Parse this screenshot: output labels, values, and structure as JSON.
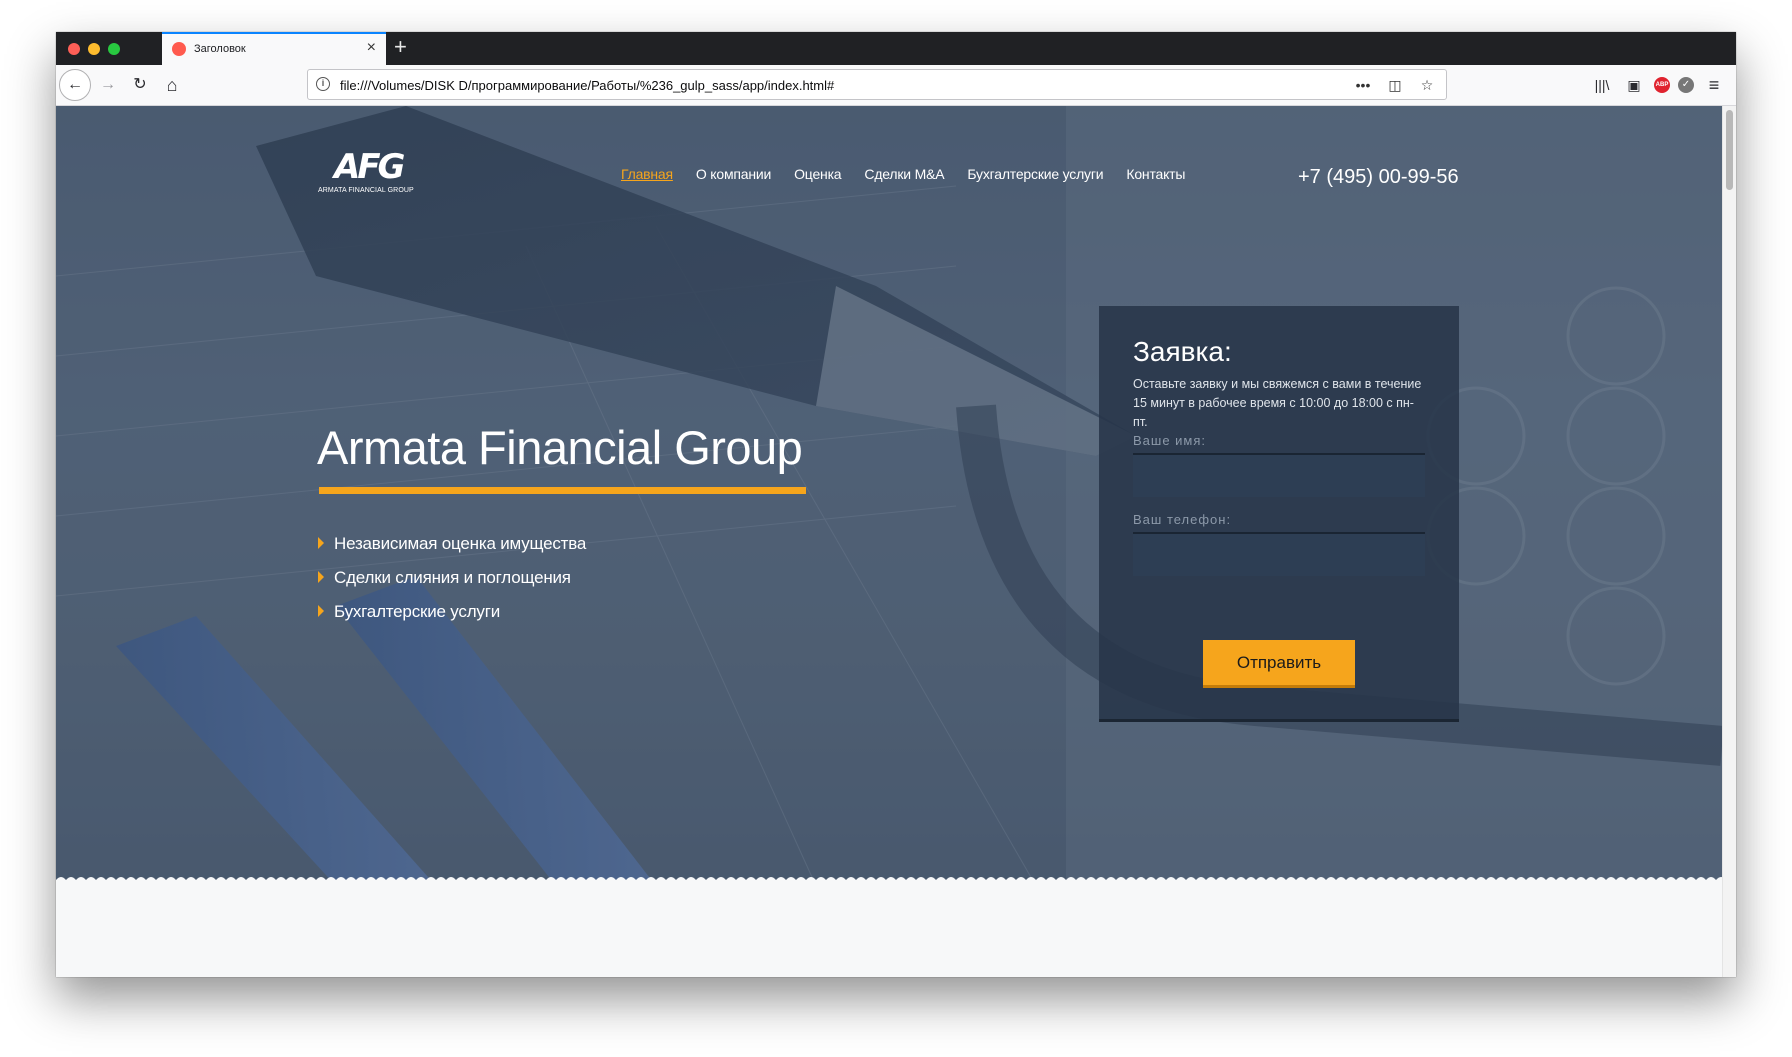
{
  "browser": {
    "tab": {
      "title": "Заголовок",
      "close_icon": "×"
    },
    "new_tab_icon": "+",
    "url": "file:///Volumes/DISK D/программирование/Работы/%236_gulp_sass/app/index.html#",
    "url_actions": {
      "more": "•••",
      "pocket": "◫",
      "bookmark": "☆"
    },
    "icons": {
      "back": "←",
      "forward": "→",
      "reload": "↻",
      "home": "⌂",
      "library": "|||\\",
      "sidebar": "▣",
      "adblock": "ABP",
      "addon": "✓",
      "menu": "≡"
    }
  },
  "site": {
    "logo": {
      "mark": "AFG",
      "subtitle": "ARMATA FINANCIAL GROUP"
    },
    "nav": [
      {
        "label": "Главная",
        "active": true
      },
      {
        "label": "О компании",
        "active": false
      },
      {
        "label": "Оценка",
        "active": false
      },
      {
        "label": "Сделки М&А",
        "active": false
      },
      {
        "label": "Бухгалтерские услуги",
        "active": false
      },
      {
        "label": "Контакты",
        "active": false
      }
    ],
    "phone": "+7 (495) 00-99-56",
    "hero": {
      "title": "Armata Financial Group",
      "features": [
        "Независимая оценка имущества",
        "Сделки слияния и поглощения",
        "Бухгалтерские услуги"
      ]
    },
    "form": {
      "title": "Заявка:",
      "description": "Оставьте заявку и мы свяжемся с вами в течение 15 минут в рабочее время с 10:00 до 18:00 с пн-пт.",
      "name_label": "Ваше имя:",
      "name_value": "",
      "phone_label": "Ваш телефон:",
      "phone_value": "",
      "submit_label": "Отправить"
    },
    "colors": {
      "accent": "#f6a51c",
      "hero_overlay": "#4e5f75",
      "form_bg": "#263448",
      "input_bg": "#2d3e54"
    }
  }
}
